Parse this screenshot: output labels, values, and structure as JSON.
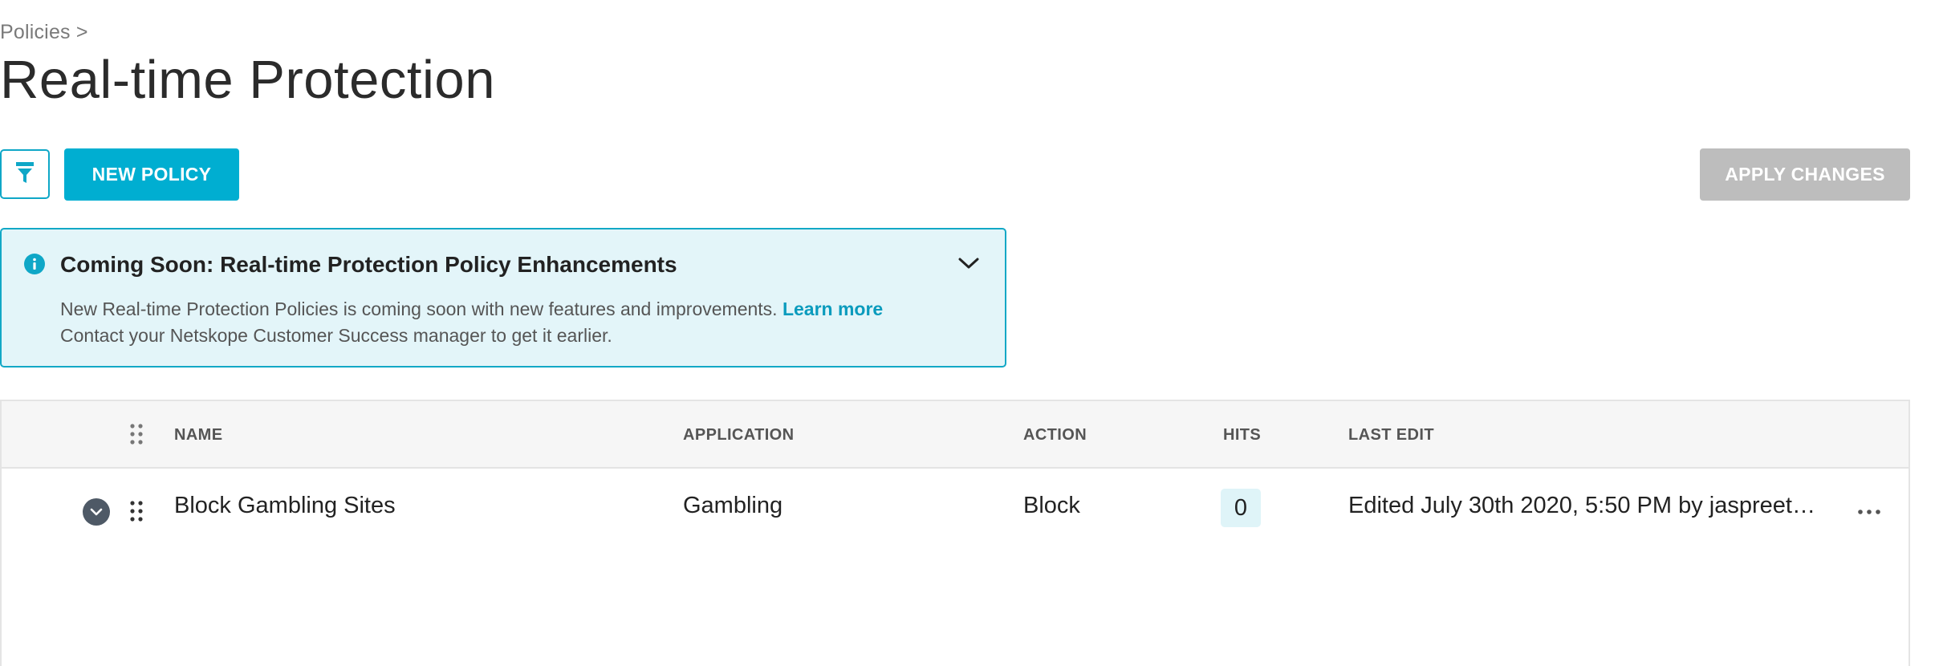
{
  "breadcrumb": {
    "label": "Policies >"
  },
  "page": {
    "title": "Real-time Protection"
  },
  "toolbar": {
    "filter_icon": "filter-icon",
    "new_policy_label": "NEW POLICY",
    "apply_changes_label": "APPLY CHANGES"
  },
  "banner": {
    "icon": "info-icon",
    "title": "Coming Soon: Real-time Protection Policy Enhancements",
    "line1": "New Real-time Protection Policies is coming soon with new features and improvements.",
    "link_label": "Learn more",
    "line2": "Contact your Netskope Customer Success manager to get it earlier.",
    "collapse_icon": "chevron-down-icon"
  },
  "table": {
    "columns": {
      "name": "NAME",
      "application": "APPLICATION",
      "action": "ACTION",
      "hits": "HITS",
      "last_edit": "LAST EDIT"
    },
    "rows": [
      {
        "name": "Block Gambling Sites",
        "application": "Gambling",
        "action": "Block",
        "hits": "0",
        "last_edit": "Edited July 30th 2020, 5:50 PM by jaspreet…"
      }
    ]
  },
  "colors": {
    "accent": "#00aed1",
    "banner_bg": "#e3f5f9",
    "disabled": "#bdbdbd",
    "link": "#0a9bbd"
  }
}
